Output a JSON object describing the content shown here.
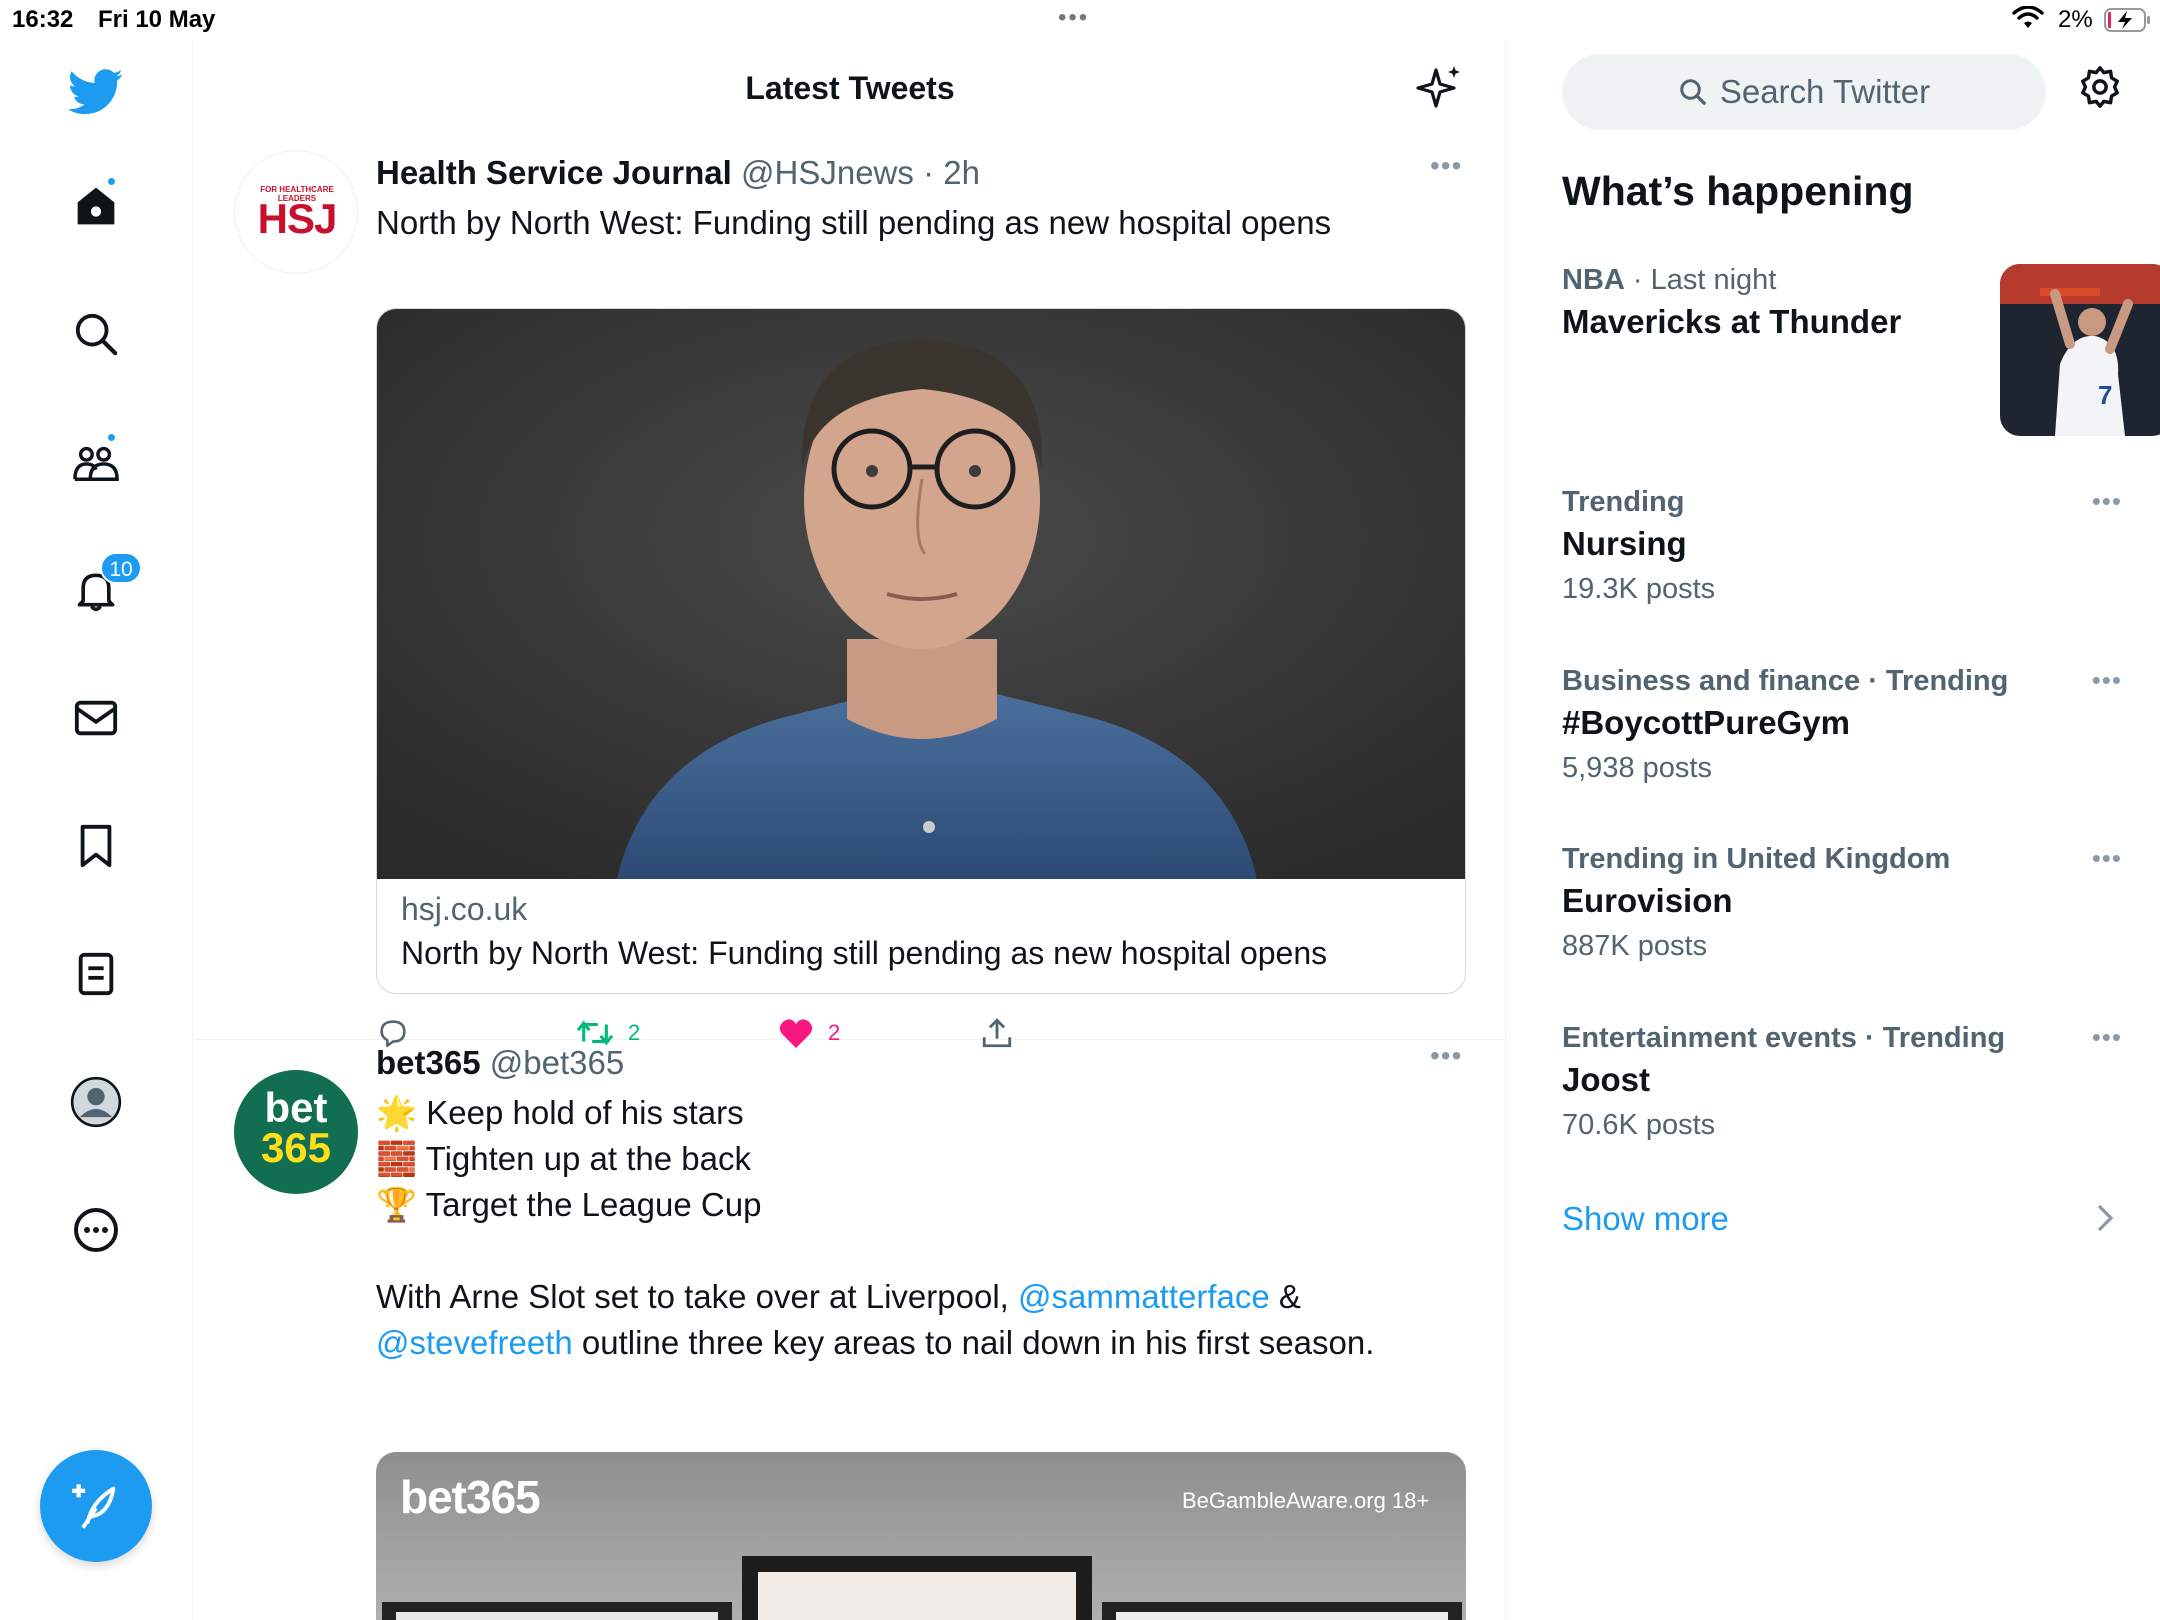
{
  "status_bar": {
    "time": "16:32",
    "date": "Fri 10 May",
    "battery": "2%"
  },
  "nav": {
    "notifications_count": "10"
  },
  "timeline": {
    "title": "Latest Tweets",
    "tweets": [
      {
        "name": "Health Service Journal",
        "handle": "@HSJnews",
        "time": "· 2h",
        "avatar_text": "HSJ",
        "avatar_caption": "FOR HEALTHCARE LEADERS",
        "text": "North by North West: Funding still pending as new hospital opens",
        "card": {
          "domain": "hsj.co.uk",
          "title": "North by North West: Funding still pending as new hospital opens"
        },
        "retweets": "2",
        "likes": "2"
      },
      {
        "name": "bet365",
        "handle": "@bet365",
        "avatar_line1": "bet",
        "avatar_line2": "365",
        "lines": [
          {
            "emoji": "🌟",
            "text": "Keep hold of his stars"
          },
          {
            "emoji": "🧱",
            "text": "Tighten up at the back"
          },
          {
            "emoji": "🏆",
            "text": "Target the League Cup"
          }
        ],
        "body_1": "With Arne Slot set to take over at Liverpool, ",
        "mention_1": "@sammatterface",
        "body_2": " &",
        "mention_2": "@stevefreeth",
        "body_3": " outline three key areas to nail down in his first season.",
        "media": {
          "logo": "bet365",
          "disclaimer": "BeGambleAware.org 18+"
        }
      }
    ]
  },
  "sidebar": {
    "search_placeholder": "Search Twitter",
    "whats_happening": "What’s happening",
    "trends": [
      {
        "category": "NBA",
        "meta_suffix": " · Last night",
        "topic": "Mavericks at Thunder",
        "count": ""
      },
      {
        "category": "Trending",
        "meta_suffix": "",
        "topic": "Nursing",
        "count": "19.3K posts"
      },
      {
        "category": "Business and finance · Trending",
        "meta_suffix": "",
        "topic": "#BoycottPureGym",
        "count": "5,938 posts"
      },
      {
        "category": "Trending in United Kingdom",
        "meta_suffix": "",
        "topic": "Eurovision",
        "count": "887K posts"
      },
      {
        "category": "Entertainment events · Trending",
        "meta_suffix": "",
        "topic": "Joost",
        "count": "70.6K posts"
      }
    ],
    "show_more": "Show more"
  },
  "colors": {
    "accent": "#1d9bf0",
    "retweet": "#00ba7c",
    "like": "#f91880",
    "text": "#0f1419",
    "secondary": "#536471"
  }
}
